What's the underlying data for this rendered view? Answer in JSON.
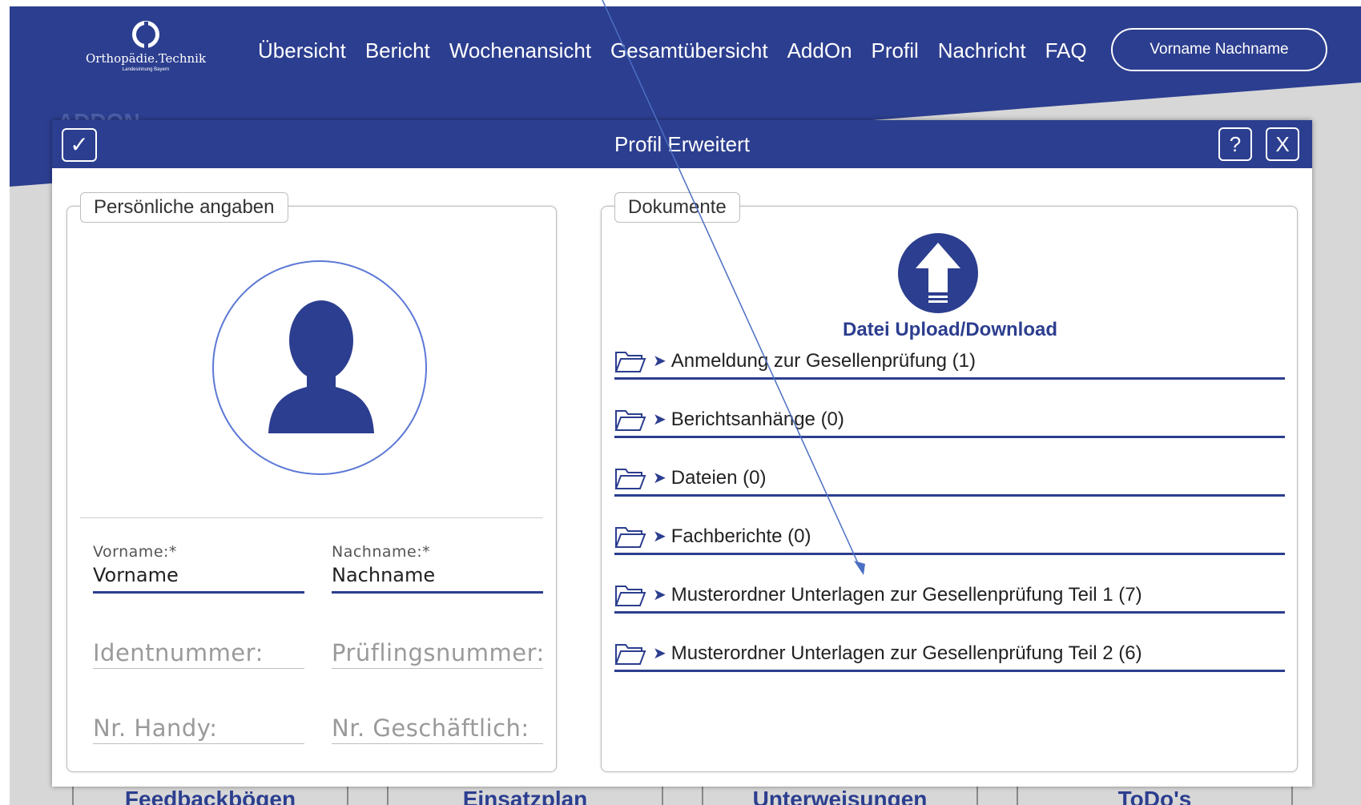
{
  "app": {
    "logo": {
      "name": "Orthopädie.Technik",
      "sub": "Landesinnung Bayern"
    },
    "nav": [
      "Übersicht",
      "Bericht",
      "Wochenansicht",
      "Gesamtübersicht",
      "AddOn",
      "Profil",
      "Nachricht",
      "FAQ"
    ],
    "user_name": "Vorname Nachname",
    "page_heading": "ADDON",
    "bottom_tabs": [
      "Feedbackbögen",
      "Einsatzplan",
      "Unterweisungen",
      "ToDo's"
    ]
  },
  "dialog": {
    "title": "Profil Erweitert",
    "check_label": "✓",
    "help_label": "?",
    "close_label": "X",
    "personal": {
      "legend": "Persönliche angaben",
      "first_name_label": "Vorname:*",
      "first_name_value": "Vorname",
      "last_name_label": "Nachname:*",
      "last_name_value": "Nachname",
      "id_placeholder": "Identnummer:",
      "exam_placeholder": "Prüflingsnummer:",
      "mobile_placeholder": "Nr. Handy:",
      "business_placeholder": "Nr. Geschäftlich:"
    },
    "documents": {
      "legend": "Dokumente",
      "upload_label": "Datei Upload/Download",
      "folders": [
        "Anmeldung zur Gesellenprüfung (1)",
        "Berichtsanhänge (0)",
        "Dateien (0)",
        "Fachberichte (0)",
        "Musterordner Unterlagen zur Gesellenprüfung Teil 1 (7)",
        "Musterordner Unterlagen zur Gesellenprüfung Teil 2 (6)"
      ]
    }
  },
  "colors": {
    "brand": "#2c3e8f",
    "accent": "#5c78d6",
    "background": "#d7d7d7"
  }
}
